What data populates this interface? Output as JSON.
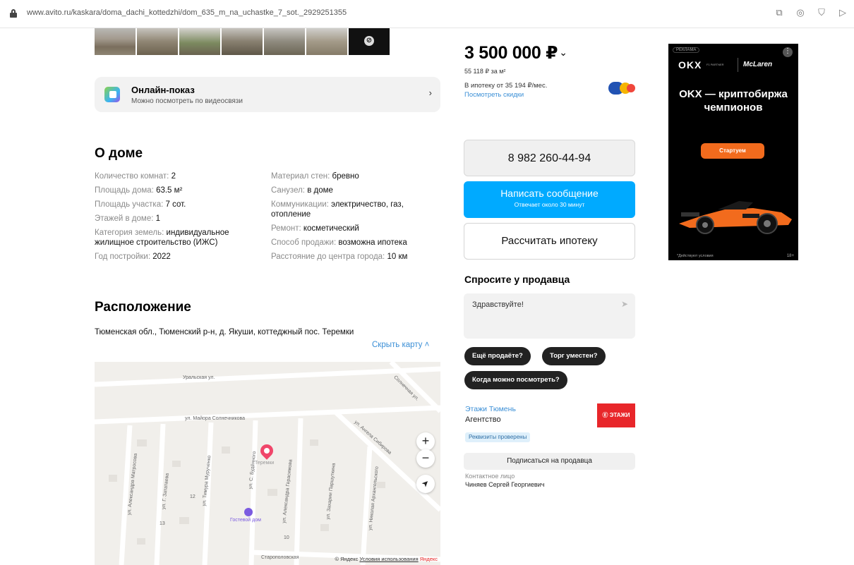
{
  "browser": {
    "url": "www.avito.ru/kaskara/doma_dachi_kottedzhi/dom_635_m_na_uchastke_7_sot._2929251355",
    "icons": [
      "share-icon",
      "camera-icon",
      "shield-icon",
      "send-icon"
    ]
  },
  "online_showing": {
    "title": "Онлайн-показ",
    "subtitle": "Можно посмотреть по видеосвязи"
  },
  "about": {
    "title": "О доме",
    "left": [
      {
        "key": "Количество комнат: ",
        "value": "2"
      },
      {
        "key": "Площадь дома: ",
        "value": "63.5 м²"
      },
      {
        "key": "Площадь участка: ",
        "value": "7 сот."
      },
      {
        "key": "Этажей в доме: ",
        "value": "1"
      },
      {
        "key": "Категория земель: ",
        "value": "индивидуальное жилищное строительство (ИЖС)"
      },
      {
        "key": "Год постройки: ",
        "value": "2022"
      }
    ],
    "right": [
      {
        "key": "Материал стен: ",
        "value": "бревно"
      },
      {
        "key": "Санузел: ",
        "value": "в доме"
      },
      {
        "key": "Коммуникации: ",
        "value": "электричество, газ, отопление"
      },
      {
        "key": "Ремонт: ",
        "value": "косметический"
      },
      {
        "key": "Способ продажи: ",
        "value": "возможна ипотека"
      },
      {
        "key": "Расстояние до центра города: ",
        "value": "10 км"
      }
    ]
  },
  "location": {
    "title": "Расположение",
    "address": "Тюменская обл., Тюменский р-н, д. Якуши, коттеджный пос. Теремки",
    "hide_map": "Скрыть карту ˄",
    "map": {
      "streets": {
        "uralskaya": "Уральская ул.",
        "solnechnikova": "ул. Майора Солнечникова",
        "sibirskaya": "ул. Ангела Сибирова",
        "solnechnaya": "Солнечная ул.",
        "matrosova": "ул. Александра Матросова",
        "zatateva": "ул. Г. Зататаева",
        "muruchenko": "ул. Тимура Мурученко",
        "budennogo": "ул. С. Будённого",
        "gerasimova": "ул. Александра Герасимова",
        "parshutkin": "ул. Захарии Паршуткина",
        "arkhangelsky": "ул. Николая Архангельского",
        "staropolovskaya": "Старополовская"
      },
      "pin_label": "Теремки",
      "poi_label": "Гостевой дом",
      "house_numbers": [
        "12",
        "13",
        "10"
      ],
      "zoom_in": "+",
      "zoom_out": "−",
      "locate": "➤",
      "copyright": "© Яндекс ",
      "terms": "Условия использования",
      "brand": "Яндекс"
    }
  },
  "price": {
    "value": "3 500 000 ₽",
    "caret": "⌄",
    "per_m2": "55 118 ₽ за м²",
    "mortgage": "В ипотеку от 35 194 ₽/мес.",
    "discounts": "Посмотреть скидки"
  },
  "actions": {
    "phone": "8 982 260-44-94",
    "message": "Написать сообщение",
    "message_sub": "Отвечает около 30 минут",
    "mortgage_calc": "Рассчитать ипотеку"
  },
  "ask": {
    "title": "Спросите у продавца",
    "placeholder": "Здравствуйте!",
    "send": "➤",
    "chips": [
      "Ещё продаёте?",
      "Торг уместен?",
      "Когда можно посмотреть?"
    ]
  },
  "seller": {
    "name": "Этажи Тюмень",
    "type": "Агентство",
    "logo_text": "Ⓔ ЭТАЖИ",
    "verified": "Реквизиты проверены",
    "subscribe": "Подписаться на продавца",
    "contact_label": "Контактное лицо",
    "contact_name": "Чиняев Сергей Георгиевич"
  },
  "ad": {
    "label": "РЕКЛАМА",
    "more": "⋮",
    "okx": "OKX",
    "okx_sub": "F1 PARTNER",
    "mclaren": "McLaren",
    "headline": "OKX — криптобиржа чемпионов",
    "cta": "Стартуем",
    "disclaimer": "*Действуют условия",
    "age": "18+"
  },
  "colors": {
    "accent_blue": "#00aaff",
    "link_blue": "#3b8fd6",
    "chip_dark": "#222222",
    "ad_orange": "#f26b1d",
    "pin_red": "#f0466a",
    "agency_red": "#e8262a"
  }
}
